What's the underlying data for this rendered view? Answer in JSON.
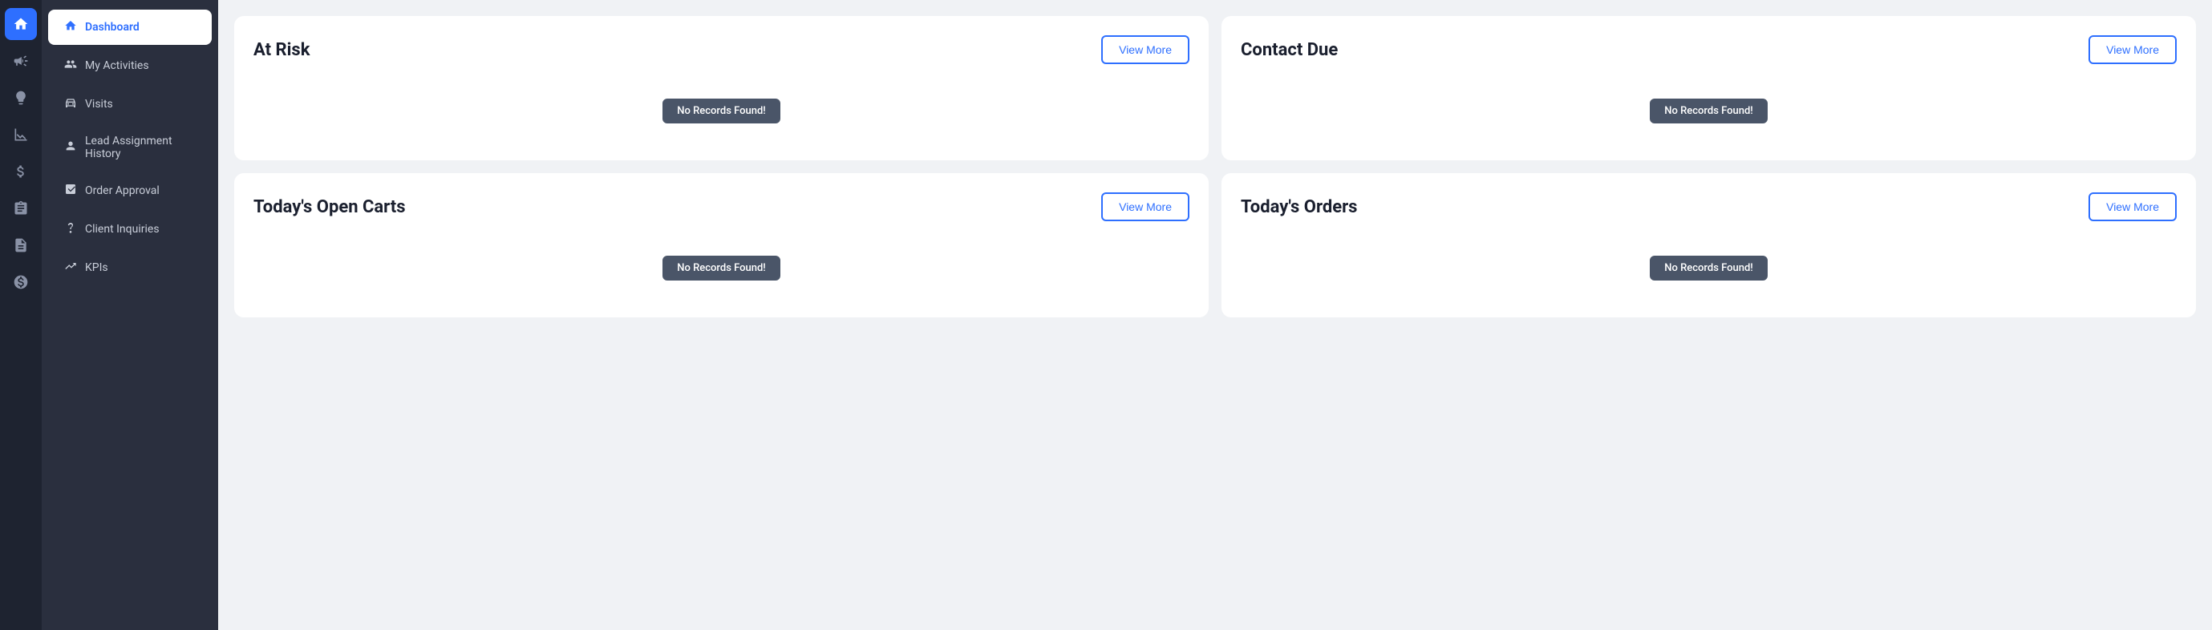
{
  "icon_sidebar": {
    "items": [
      {
        "name": "home-icon",
        "icon": "🏠",
        "active": true
      },
      {
        "name": "megaphone-icon",
        "icon": "📢",
        "active": false
      },
      {
        "name": "bulb-icon",
        "icon": "💡",
        "active": false
      },
      {
        "name": "chart-bar-icon",
        "icon": "📊",
        "active": false
      },
      {
        "name": "dollar-icon",
        "icon": "💵",
        "active": false
      },
      {
        "name": "clipboard-icon",
        "icon": "📋",
        "active": false
      },
      {
        "name": "document-icon",
        "icon": "📄",
        "active": false
      },
      {
        "name": "coin-icon",
        "icon": "🪙",
        "active": false
      }
    ]
  },
  "nav_sidebar": {
    "items": [
      {
        "id": "dashboard",
        "label": "Dashboard",
        "icon": "🏠",
        "active": true
      },
      {
        "id": "my-activities",
        "label": "My Activities",
        "icon": "👥",
        "active": false
      },
      {
        "id": "visits",
        "label": "Visits",
        "icon": "🚗",
        "active": false
      },
      {
        "id": "lead-assignment-history",
        "label": "Lead Assignment History",
        "icon": "👤",
        "active": false
      },
      {
        "id": "order-approval",
        "label": "Order Approval",
        "icon": "📋",
        "active": false
      },
      {
        "id": "client-inquiries",
        "label": "Client Inquiries",
        "icon": "❓",
        "active": false
      },
      {
        "id": "kpis",
        "label": "KPIs",
        "icon": "📈",
        "active": false
      }
    ]
  },
  "cards": [
    {
      "id": "at-risk",
      "title": "At Risk",
      "view_more_label": "View More",
      "no_records_text": "No Records Found!"
    },
    {
      "id": "contact-due",
      "title": "Contact Due",
      "view_more_label": "View More",
      "no_records_text": "No Records Found!"
    },
    {
      "id": "todays-open-carts",
      "title": "Today's Open Carts",
      "view_more_label": "View More",
      "no_records_text": "No Records Found!"
    },
    {
      "id": "todays-orders",
      "title": "Today's Orders",
      "view_more_label": "View More",
      "no_records_text": "No Records Found!"
    }
  ]
}
